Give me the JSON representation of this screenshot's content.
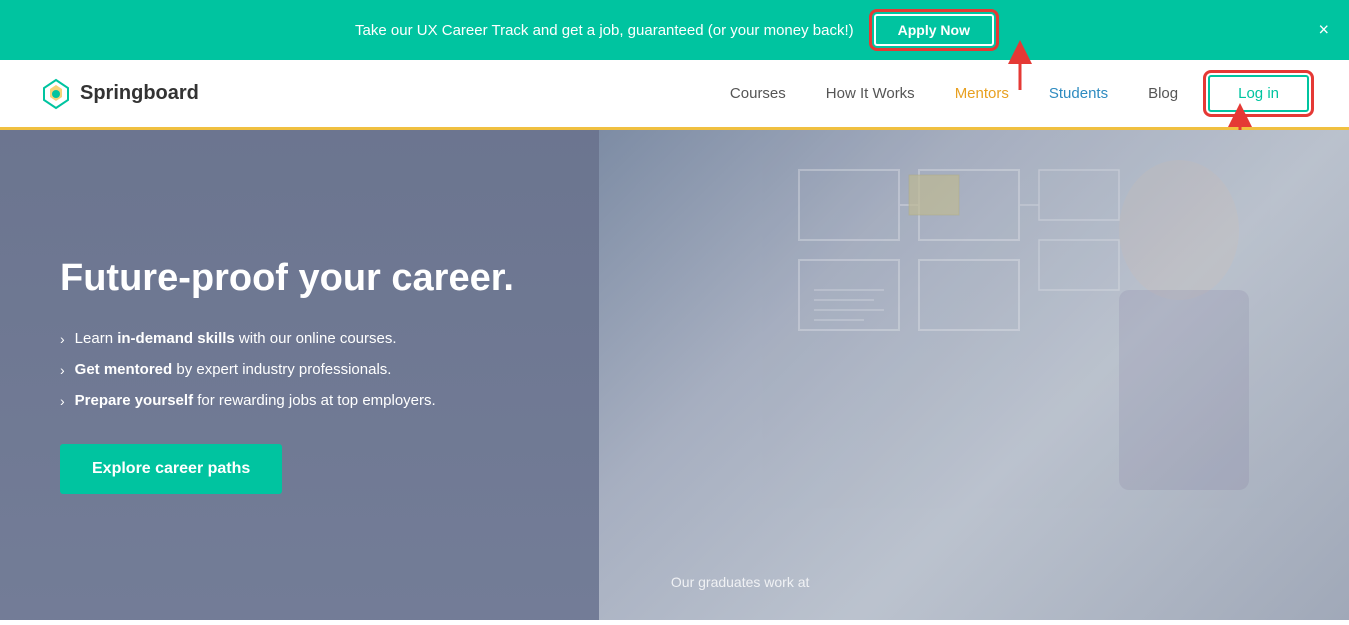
{
  "banner": {
    "text": "Take our UX Career Track and get a job, guaranteed (or your money back!)",
    "apply_button_label": "Apply Now",
    "close_label": "×"
  },
  "navbar": {
    "logo_text": "Springboard",
    "nav_items": [
      {
        "label": "Courses",
        "type": "default"
      },
      {
        "label": "How It Works",
        "type": "default"
      },
      {
        "label": "Mentors",
        "type": "mentors"
      },
      {
        "label": "Students",
        "type": "students"
      },
      {
        "label": "Blog",
        "type": "default"
      }
    ],
    "login_label": "Log in"
  },
  "hero": {
    "title": "Future-proof your career.",
    "bullets": [
      {
        "prefix": "Learn ",
        "bold": "in-demand skills",
        "suffix": " with our online courses."
      },
      {
        "prefix": "Get ",
        "bold": "mentored",
        "suffix": " by expert industry professionals."
      },
      {
        "prefix": "Prepare ",
        "bold": "yourself",
        "suffix": " for rewarding jobs at top employers."
      }
    ],
    "cta_label": "Explore career paths",
    "graduates_text": "Our graduates work at"
  }
}
